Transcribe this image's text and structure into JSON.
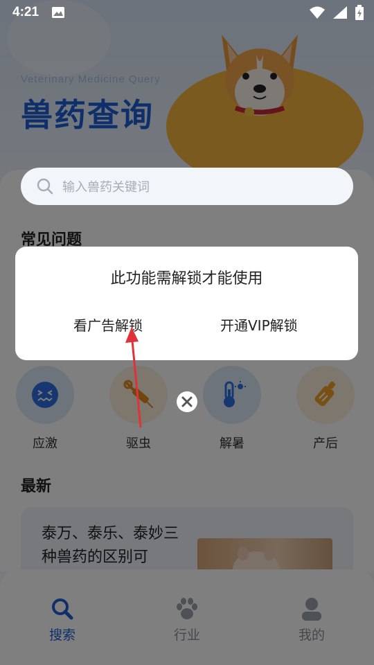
{
  "status_bar": {
    "time": "4:21"
  },
  "hero": {
    "subtitle_en": "Veterinary Medicine Query",
    "title_cn": "兽药查询"
  },
  "search": {
    "placeholder": "输入兽药关键词"
  },
  "sections": {
    "faq_title": "常见问题",
    "latest_title": "最新"
  },
  "categories": [
    {
      "label": "应激",
      "icon": "stress-face-icon",
      "color": "#2f6fe0"
    },
    {
      "label": "驱虫",
      "icon": "syringe-icon",
      "color": "#e08a1e"
    },
    {
      "label": "解暑",
      "icon": "thermometer-icon",
      "color": "#2f6fe0"
    },
    {
      "label": "产后",
      "icon": "baby-bottle-icon",
      "color": "#f0a128"
    }
  ],
  "news": {
    "title": "泰万、泰乐、泰妙三种兽药的区别可"
  },
  "tabbar": {
    "items": [
      {
        "label": "搜索",
        "icon": "search-icon",
        "active": true
      },
      {
        "label": "行业",
        "icon": "paw-icon",
        "active": false
      },
      {
        "label": "我的",
        "icon": "user-icon",
        "active": false
      }
    ]
  },
  "dialog": {
    "message": "此功能需解锁才能使用",
    "watch_ad_label": "看广告解锁",
    "vip_label": "开通VIP解锁"
  },
  "colors": {
    "brand_blue": "#1e5fd6",
    "accent_orange": "#f7b53f",
    "annotation_arrow": "#e0323a"
  }
}
